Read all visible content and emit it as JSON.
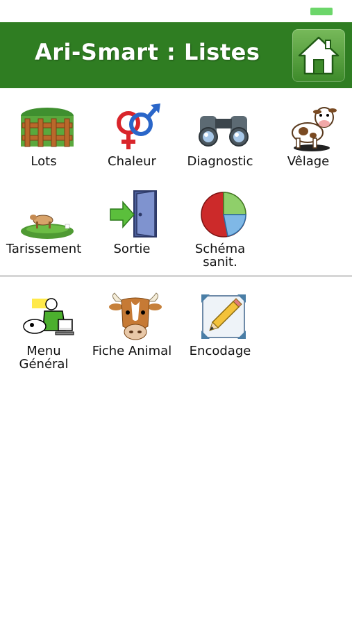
{
  "app": {
    "title": "Ari-Smart : Listes"
  },
  "header": {
    "home_icon": "home-icon"
  },
  "colors": {
    "header_bg": "#2f7d22",
    "battery": "#6cd66a"
  },
  "lists": [
    {
      "label": "Lots",
      "icon": "fence-icon"
    },
    {
      "label": "Chaleur",
      "icon": "gender-symbols-icon"
    },
    {
      "label": "Diagnostic",
      "icon": "binoculars-icon"
    },
    {
      "label": "Vêlage",
      "icon": "calf-icon"
    },
    {
      "label": "Tarissement",
      "icon": "cow-pasture-icon"
    },
    {
      "label": "Sortie",
      "icon": "exit-door-icon"
    },
    {
      "label": "Schéma\nsanit.",
      "icon": "pie-chart-icon"
    }
  ],
  "tools": [
    {
      "label": "Menu\nGénéral",
      "icon": "farmer-computer-icon"
    },
    {
      "label": "Fiche Animal",
      "icon": "cow-head-icon"
    },
    {
      "label": "Encodage",
      "icon": "pencil-edit-icon"
    }
  ]
}
